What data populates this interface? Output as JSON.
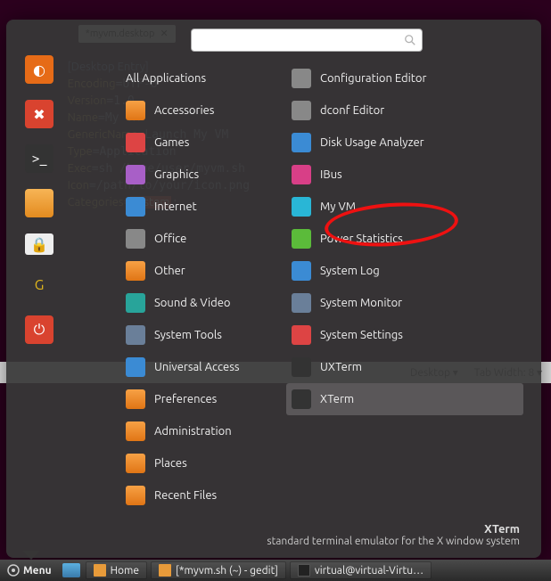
{
  "editor": {
    "tab_title": "*myvm.desktop",
    "lines": [
      "[Desktop Entry]",
      "Encoding=UTF-8",
      "Version=1.0",
      "Name=My VM",
      "GenericName=Launch My VM",
      "Type=Application",
      "Exec=sh /home/user/myvm.sh",
      "Icon=/path/to/your/icon.png",
      "Categories=System;"
    ]
  },
  "status_bar": {
    "desktop_label": "Desktop ▾",
    "tab_width_label": "Tab Width: 8 ▾"
  },
  "search": {
    "placeholder": ""
  },
  "categories": {
    "header": "All Applications",
    "items": [
      {
        "label": "Accessories",
        "color": "ic-orange"
      },
      {
        "label": "Games",
        "color": "ic-red"
      },
      {
        "label": "Graphics",
        "color": "ic-purple"
      },
      {
        "label": "Internet",
        "color": "ic-blue"
      },
      {
        "label": "Office",
        "color": "ic-grey"
      },
      {
        "label": "Other",
        "color": "ic-orange"
      },
      {
        "label": "Sound & Video",
        "color": "ic-teal"
      },
      {
        "label": "System Tools",
        "color": "ic-steel"
      },
      {
        "label": "Universal Access",
        "color": "ic-blue"
      },
      {
        "label": "Preferences",
        "color": "ic-orange"
      },
      {
        "label": "Administration",
        "color": "ic-orange"
      },
      {
        "label": "Places",
        "color": "ic-orange"
      },
      {
        "label": "Recent Files",
        "color": "ic-orange"
      }
    ]
  },
  "apps": {
    "items": [
      {
        "label": "Configuration Editor",
        "color": "ic-grey"
      },
      {
        "label": "dconf Editor",
        "color": "ic-grey"
      },
      {
        "label": "Disk Usage Analyzer",
        "color": "ic-blue"
      },
      {
        "label": "IBus",
        "color": "ic-pink"
      },
      {
        "label": "My VM",
        "color": "ic-cyan",
        "circled": true
      },
      {
        "label": "Power Statistics",
        "color": "ic-green"
      },
      {
        "label": "System Log",
        "color": "ic-blue"
      },
      {
        "label": "System Monitor",
        "color": "ic-steel"
      },
      {
        "label": "System Settings",
        "color": "ic-red"
      },
      {
        "label": "UXTerm",
        "color": "ic-dark"
      },
      {
        "label": "XTerm",
        "color": "ic-dark",
        "selected": true
      }
    ]
  },
  "tooltip": {
    "title": "XTerm",
    "desc": "standard terminal emulator for the X window system"
  },
  "launcher": [
    {
      "name": "firefox",
      "bg": "#e66b17",
      "glyph": "◐"
    },
    {
      "name": "settings",
      "bg": "#d9432f",
      "glyph": "✖"
    },
    {
      "name": "terminal",
      "bg": "#333",
      "glyph": ">_"
    },
    {
      "name": "folder",
      "bg": "folder",
      "glyph": ""
    },
    {
      "name": "lock",
      "bg": "lock",
      "glyph": "🔒"
    },
    {
      "name": "google",
      "bg": "transparent",
      "glyph": "G",
      "color": "#e2b81c"
    },
    {
      "name": "power",
      "bg": "#d9432f",
      "glyph": "⏻"
    }
  ],
  "panel": {
    "menu_label": "Menu",
    "tasks": [
      {
        "label": "Home",
        "icon": "folder"
      },
      {
        "label": "[*myvm.sh (~) - gedit]",
        "icon": "folder"
      },
      {
        "label": "virtual@virtual-Virtu…",
        "icon": "term"
      }
    ]
  }
}
